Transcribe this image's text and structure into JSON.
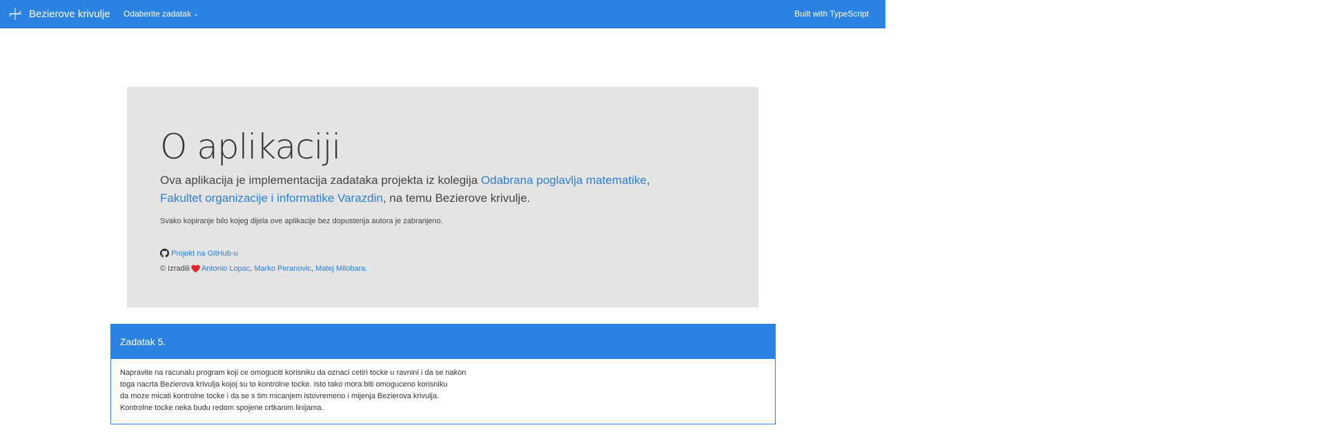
{
  "navbar": {
    "brand_title": "Bezierove krivulje",
    "dropdown_label": "Odaberite zadatak",
    "built_with": "Built with TypeScript",
    "brand_icon": "bezier-curve-icon",
    "bg_color": "#2b82e0"
  },
  "jumbotron": {
    "title": "O aplikaciji",
    "lead_part1": "Ova aplikacija je implementacija zadataka projekta iz kolegija ",
    "lead_link1": "Odabrana poglavlja matematike",
    "lead_part2": ",",
    "lead_link2": "Fakultet organizacije i informatike Varazdin",
    "lead_part3": ", na temu Bezierove krivulje.",
    "notice": "Svako kopiranje bilo kojeg dijela ove aplikacije bez dopustenja autora je zabranjeno.",
    "github_link": "Projekt na GitHub-u",
    "credits_prefix": "© Izradili",
    "author1": "Antonio Lopac",
    "author2": "Marko Peranovic",
    "author3": "Matej Milobara.",
    "sep": ", "
  },
  "task": {
    "title": "Zadatak 5.",
    "lines": [
      "Napravite na racunalu program koji ce omoguciti korisniku da oznaci cetiri tocke u ravnini i da se nakon",
      "toga nacrta Bezierova krivulja kojoj su to kontrolne tocke. Isto tako mora biti omoguceno korisniku",
      "da moze micati kontrolne tocke i da se s tim micanjem istovremeno i mijenja Bezierova krivulja.",
      "Kontrolne tocke neka budu redom spojene crtkanim linijama."
    ]
  }
}
